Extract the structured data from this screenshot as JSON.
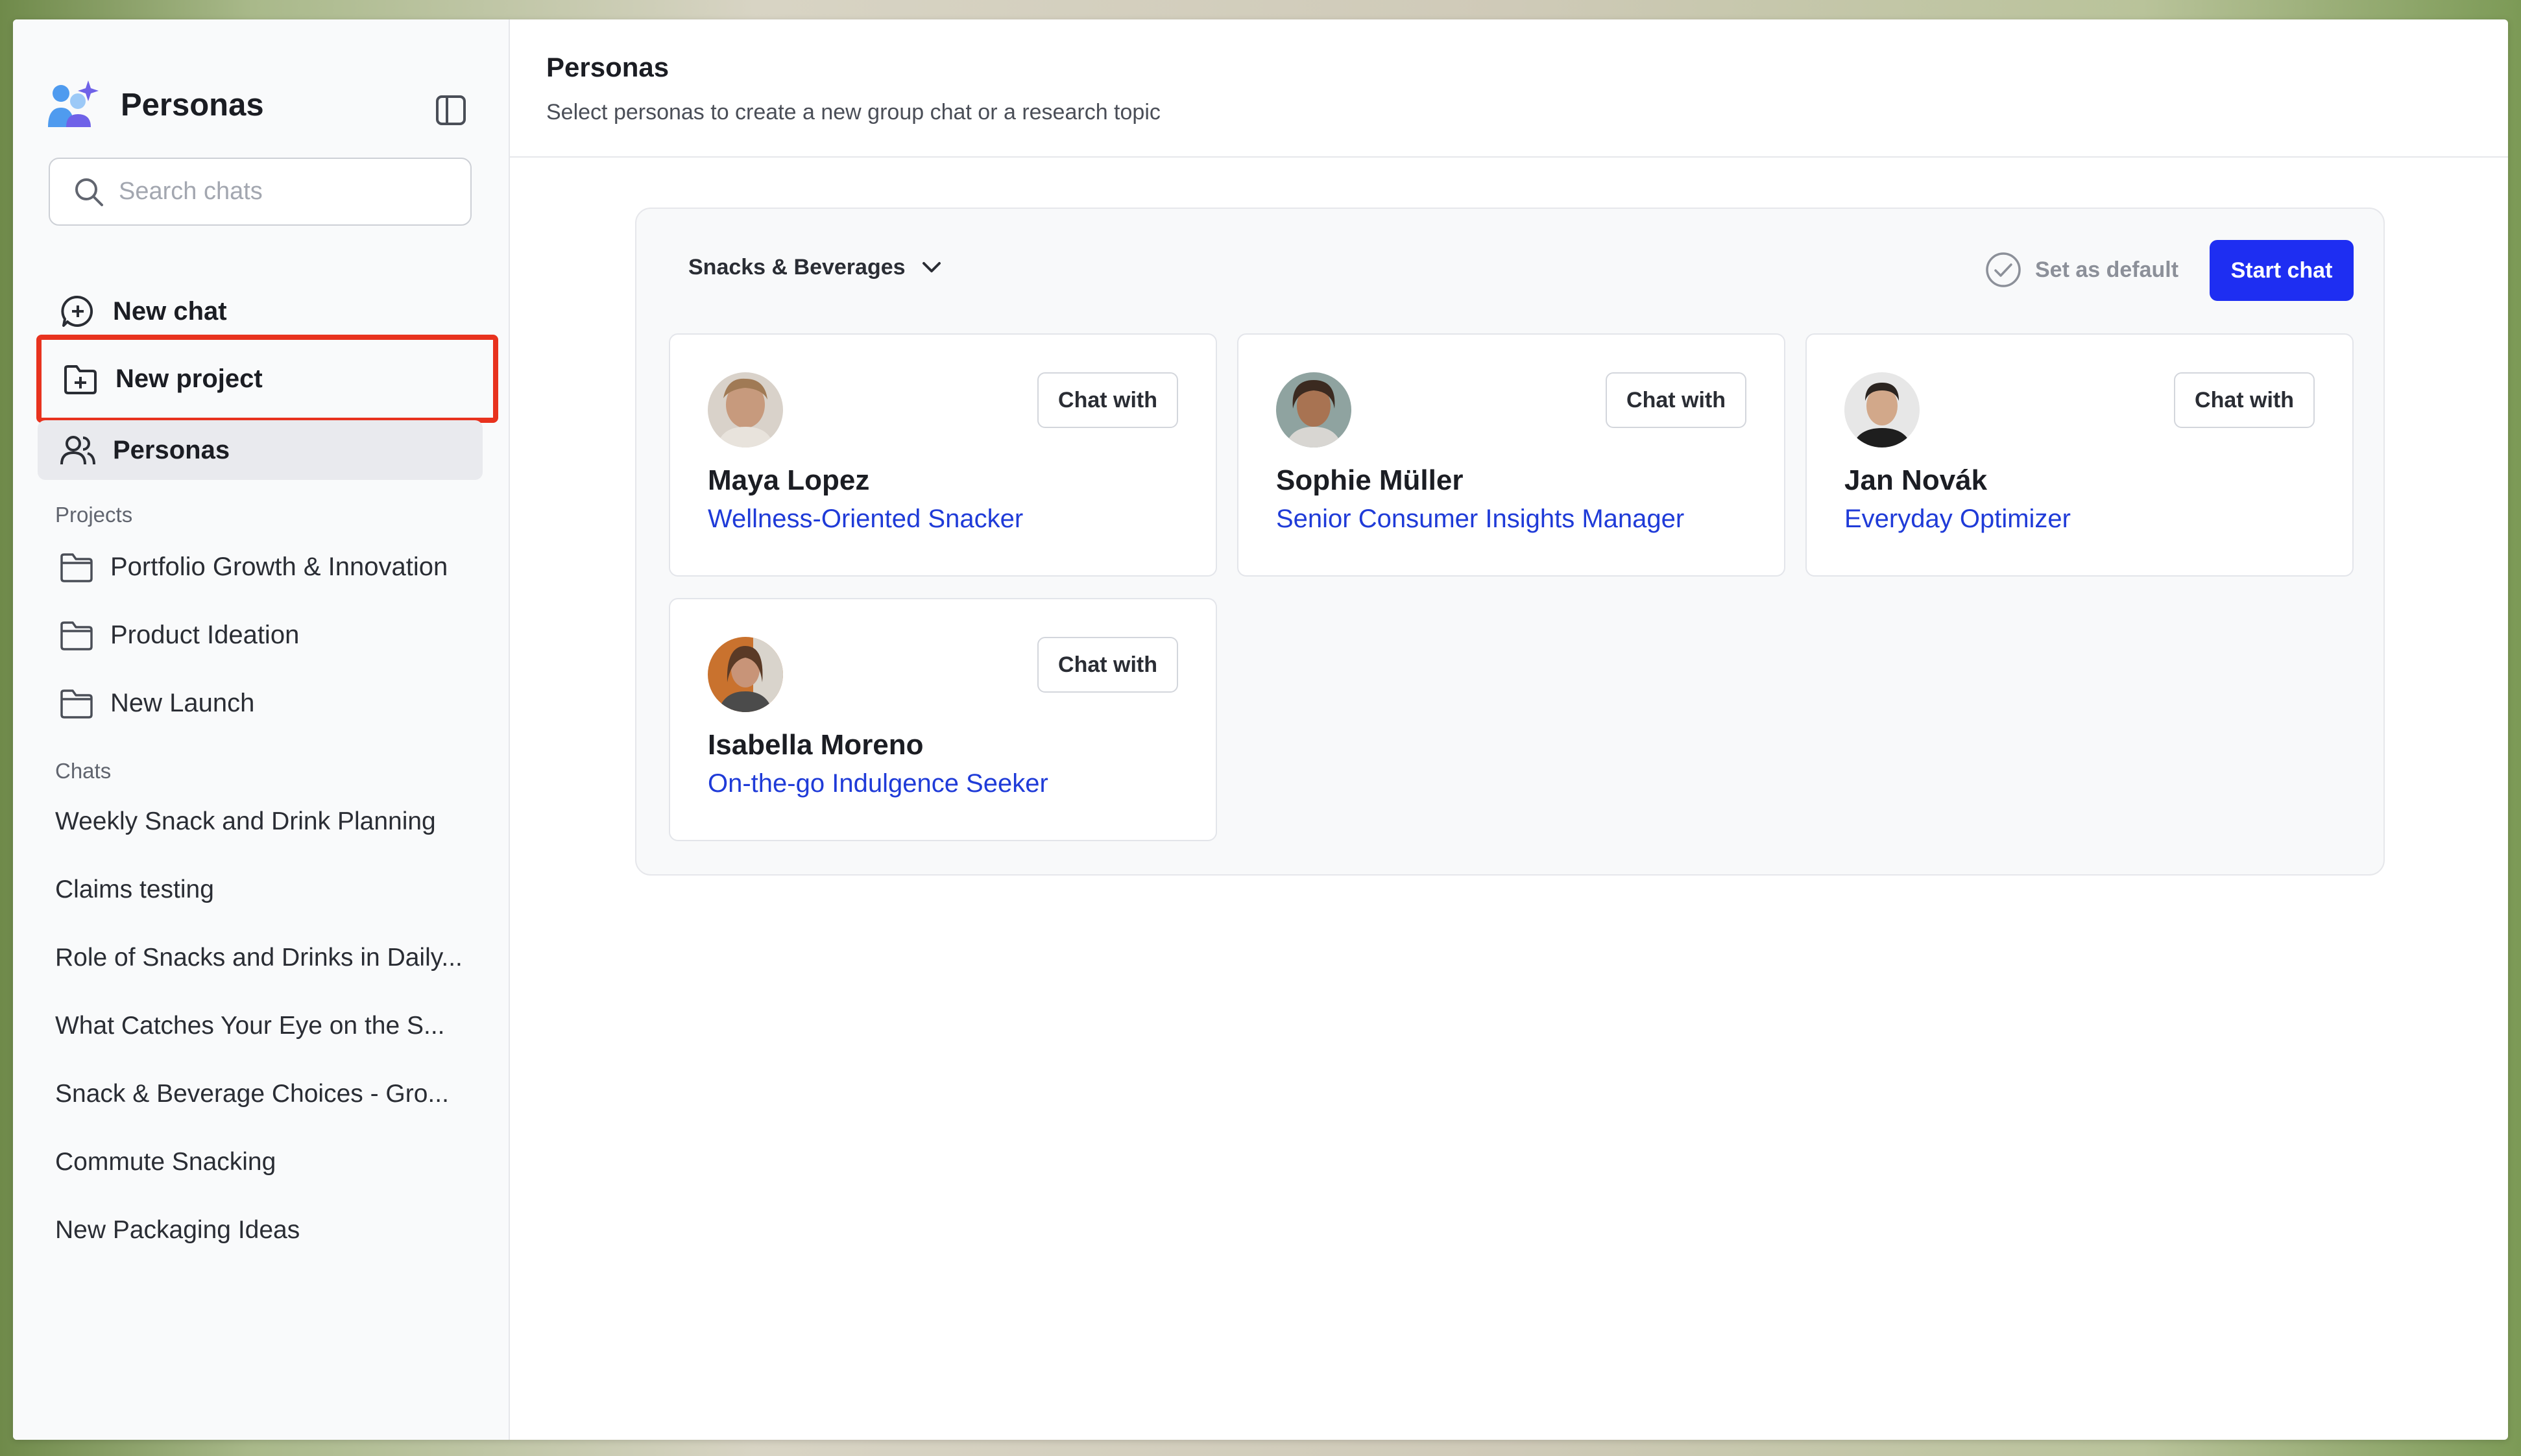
{
  "app": {
    "title": "Personas"
  },
  "search": {
    "placeholder": "Search chats"
  },
  "nav": {
    "new_chat": "New chat",
    "new_project": "New project",
    "personas": "Personas"
  },
  "projects": {
    "label": "Projects",
    "items": [
      "Portfolio Growth & Innovation",
      "Product Ideation",
      "New Launch"
    ]
  },
  "chats": {
    "label": "Chats",
    "items": [
      "Weekly Snack and Drink Planning",
      "Claims testing",
      "Role of Snacks and Drinks in Daily...",
      "What Catches Your Eye on the S...",
      "Snack & Beverage Choices - Gro...",
      "Commute Snacking",
      "New Packaging Ideas"
    ]
  },
  "header": {
    "title": "Personas",
    "subtitle": "Select personas to create a new group chat or a research topic"
  },
  "panel": {
    "category": "Snacks & Beverages",
    "set_default": "Set as default",
    "start_chat": "Start chat"
  },
  "personas": [
    {
      "name": "Maya Lopez",
      "role": "Wellness-Oriented Snacker",
      "button": "Chat with"
    },
    {
      "name": "Sophie Müller",
      "role": "Senior Consumer Insights Manager",
      "button": "Chat with"
    },
    {
      "name": "Jan Novák",
      "role": "Everyday Optimizer",
      "button": "Chat with"
    },
    {
      "name": "Isabella Moreno",
      "role": "On-the-go Indulgence Seeker",
      "button": "Chat with"
    }
  ],
  "colors": {
    "accent": "#1e2ef2",
    "role_link": "#1f3bd8",
    "highlight": "#e8321e"
  }
}
